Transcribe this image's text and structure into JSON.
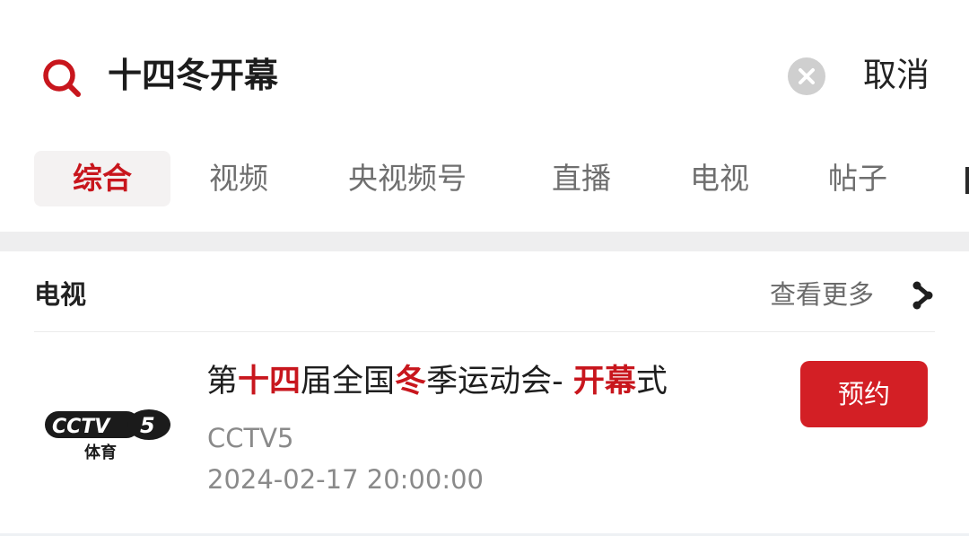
{
  "search": {
    "query": "十四冬开幕",
    "clear_icon": "clear-icon",
    "cancel_label": "取消",
    "accent_color": "#c8161d"
  },
  "tabs": [
    {
      "label": "综合",
      "active": true
    },
    {
      "label": "视频",
      "active": false
    },
    {
      "label": "央视频号",
      "active": false
    },
    {
      "label": "直播",
      "active": false
    },
    {
      "label": "电视",
      "active": false
    },
    {
      "label": "帖子",
      "active": false
    }
  ],
  "tv_section": {
    "title": "电视",
    "see_more_label": "查看更多",
    "see_more_icon": "chevron-right-icon"
  },
  "program": {
    "title_segments": [
      {
        "text": "第",
        "highlight": false
      },
      {
        "text": "十四",
        "highlight": true
      },
      {
        "text": "届全国",
        "highlight": false
      },
      {
        "text": "冬",
        "highlight": true
      },
      {
        "text": "季运动会- ",
        "highlight": false
      },
      {
        "text": "开幕",
        "highlight": true
      },
      {
        "text": "式",
        "highlight": false
      }
    ],
    "channel": "CCTV5",
    "time": "2024-02-17 20:00:00",
    "reserve_label": "预约",
    "logo": {
      "brand_text": "CCTV",
      "channel_number": "5",
      "subtitle": "体育"
    },
    "reserve_color": "#d31f25"
  }
}
